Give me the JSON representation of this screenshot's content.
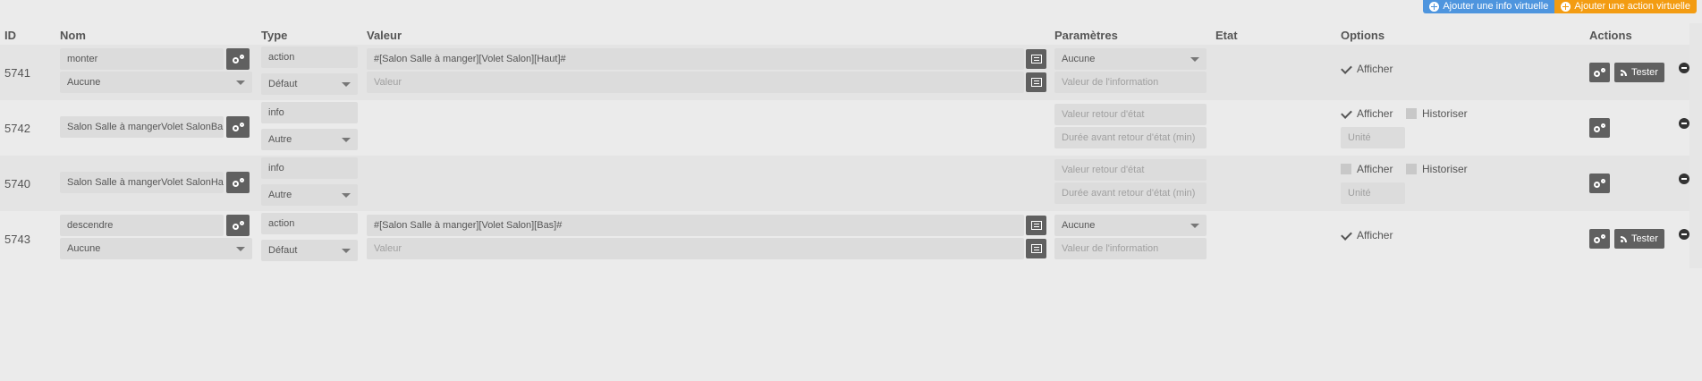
{
  "top_buttons": {
    "add_info": "Ajouter une info virtuelle",
    "add_action": "Ajouter une action virtuelle"
  },
  "headers": {
    "id": "ID",
    "nom": "Nom",
    "type": "Type",
    "valeur": "Valeur",
    "parametres": "Paramètres",
    "etat": "Etat",
    "options": "Options",
    "actions": "Actions"
  },
  "rows": [
    {
      "id": "5741",
      "name": "monter",
      "subname": "Aucune",
      "type": "action",
      "subtype": "Défaut",
      "value": "#[Salon Salle à manger][Volet Salon][Haut]#",
      "value_placeholder": "Valeur",
      "param1": "Aucune",
      "param2_placeholder": "Valeur de l'information",
      "opt_afficher": "Afficher",
      "tester": "Tester"
    },
    {
      "id": "5742",
      "name": "Salon Salle à mangerVolet SalonBa",
      "type": "info",
      "subtype": "Autre",
      "param1_placeholder": "Valeur retour d'état",
      "param2_placeholder": "Durée avant retour d'état (min)",
      "opt_afficher": "Afficher",
      "opt_historiser": "Historiser",
      "unit_placeholder": "Unité"
    },
    {
      "id": "5740",
      "name": "Salon Salle à mangerVolet SalonHa",
      "type": "info",
      "subtype": "Autre",
      "param1_placeholder": "Valeur retour d'état",
      "param2_placeholder": "Durée avant retour d'état (min)",
      "opt_afficher": "Afficher",
      "opt_historiser": "Historiser",
      "unit_placeholder": "Unité"
    },
    {
      "id": "5743",
      "name": "descendre",
      "subname": "Aucune",
      "type": "action",
      "subtype": "Défaut",
      "value": "#[Salon Salle à manger][Volet Salon][Bas]#",
      "value_placeholder": "Valeur",
      "param1": "Aucune",
      "param2_placeholder": "Valeur de l'information",
      "opt_afficher": "Afficher",
      "tester": "Tester"
    }
  ]
}
